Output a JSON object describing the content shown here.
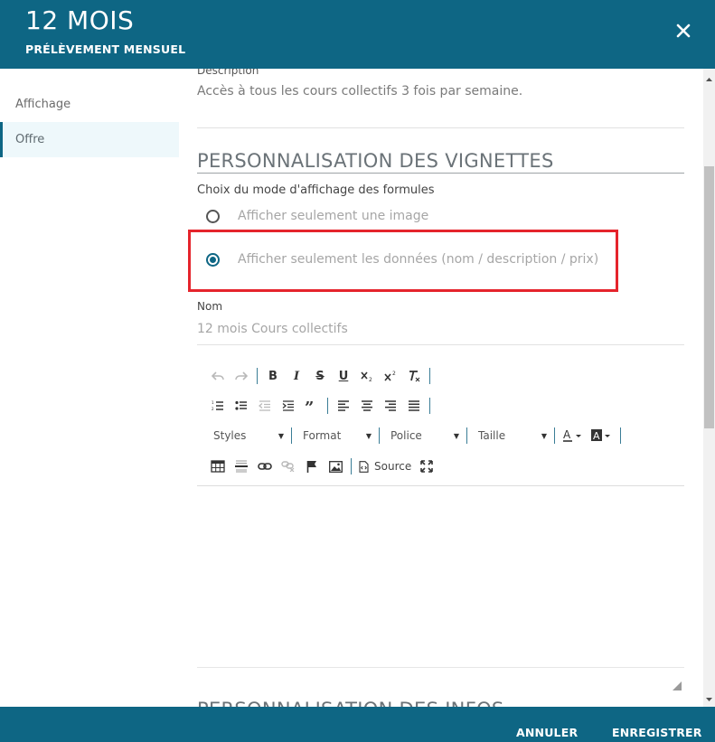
{
  "header": {
    "title": "12 MOIS",
    "subtitle": "PRÉLÈVEMENT MENSUEL"
  },
  "sidebar": {
    "items": [
      {
        "label": "Affichage",
        "active": false
      },
      {
        "label": "Offre",
        "active": true
      }
    ]
  },
  "main": {
    "description_label": "Description",
    "description_value": "Accès à tous les cours collectifs 3 fois par semaine.",
    "section_vignettes": "PERSONNALISATION DES VIGNETTES",
    "mode_label": "Choix du mode d'affichage des formules",
    "radio_options": [
      {
        "label": "Afficher seulement une image",
        "selected": false
      },
      {
        "label": "Afficher seulement les données (nom / description / prix)",
        "selected": true
      }
    ],
    "nom_label": "Nom",
    "nom_value": "12 mois Cours collectifs",
    "section_infos": "PERSONNALISATION DES INFOS"
  },
  "editor": {
    "combos": {
      "styles": "Styles",
      "format": "Format",
      "police": "Police",
      "taille": "Taille"
    },
    "source_label": "Source",
    "bold": "B",
    "italic": "I",
    "strike": "S",
    "underline": "U"
  },
  "footer": {
    "cancel_label": "ANNULER",
    "save_label": "ENREGISTRER"
  },
  "colors": {
    "brand": "#0e6684",
    "highlight": "#e5242c"
  }
}
